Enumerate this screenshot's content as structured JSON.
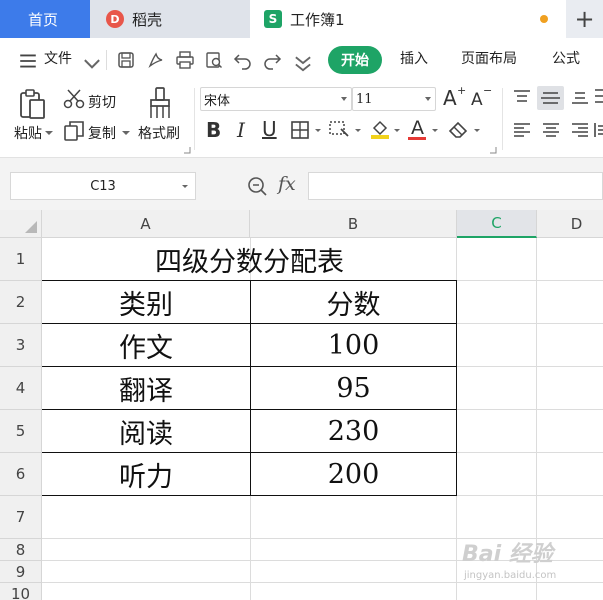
{
  "tabs": {
    "home": "首页",
    "daoke": "稻壳",
    "workbook": "工作簿1",
    "add": "+",
    "daoke_logo": "D",
    "sheet_logo": "S"
  },
  "menu": {
    "file": "文件",
    "start": "开始",
    "insert": "插入",
    "page_layout": "页面布局",
    "formula": "公式"
  },
  "ribbon": {
    "paste": "粘贴",
    "cut": "剪切",
    "copy": "复制",
    "format_painter": "格式刷",
    "font_name": "宋体",
    "font_size": "11",
    "bold": "B",
    "italic": "I",
    "underline": "U",
    "font_color_letter": "A",
    "grow_font": "A",
    "shrink_font": "A"
  },
  "formula_bar": {
    "name_box": "C13",
    "fx": "fx",
    "value": ""
  },
  "sheet": {
    "columns": [
      "A",
      "B",
      "C",
      "D"
    ],
    "rows": [
      "1",
      "2",
      "3",
      "4",
      "5",
      "6",
      "7",
      "8",
      "9",
      "10"
    ],
    "title": "四级分数分配表",
    "header": [
      "类别",
      "分数"
    ],
    "data": [
      [
        "作文",
        "100"
      ],
      [
        "翻译",
        "95"
      ],
      [
        "阅读",
        "230"
      ],
      [
        "听力",
        "200"
      ]
    ]
  },
  "watermark": {
    "main": "Bai 经验",
    "sub": "jingyan.baidu.com"
  },
  "colors": {
    "brand_green": "#1ea466",
    "home_tab_blue": "#3d7bea",
    "highlight_yellow": "#f2d21b",
    "font_red": "#e53935"
  }
}
